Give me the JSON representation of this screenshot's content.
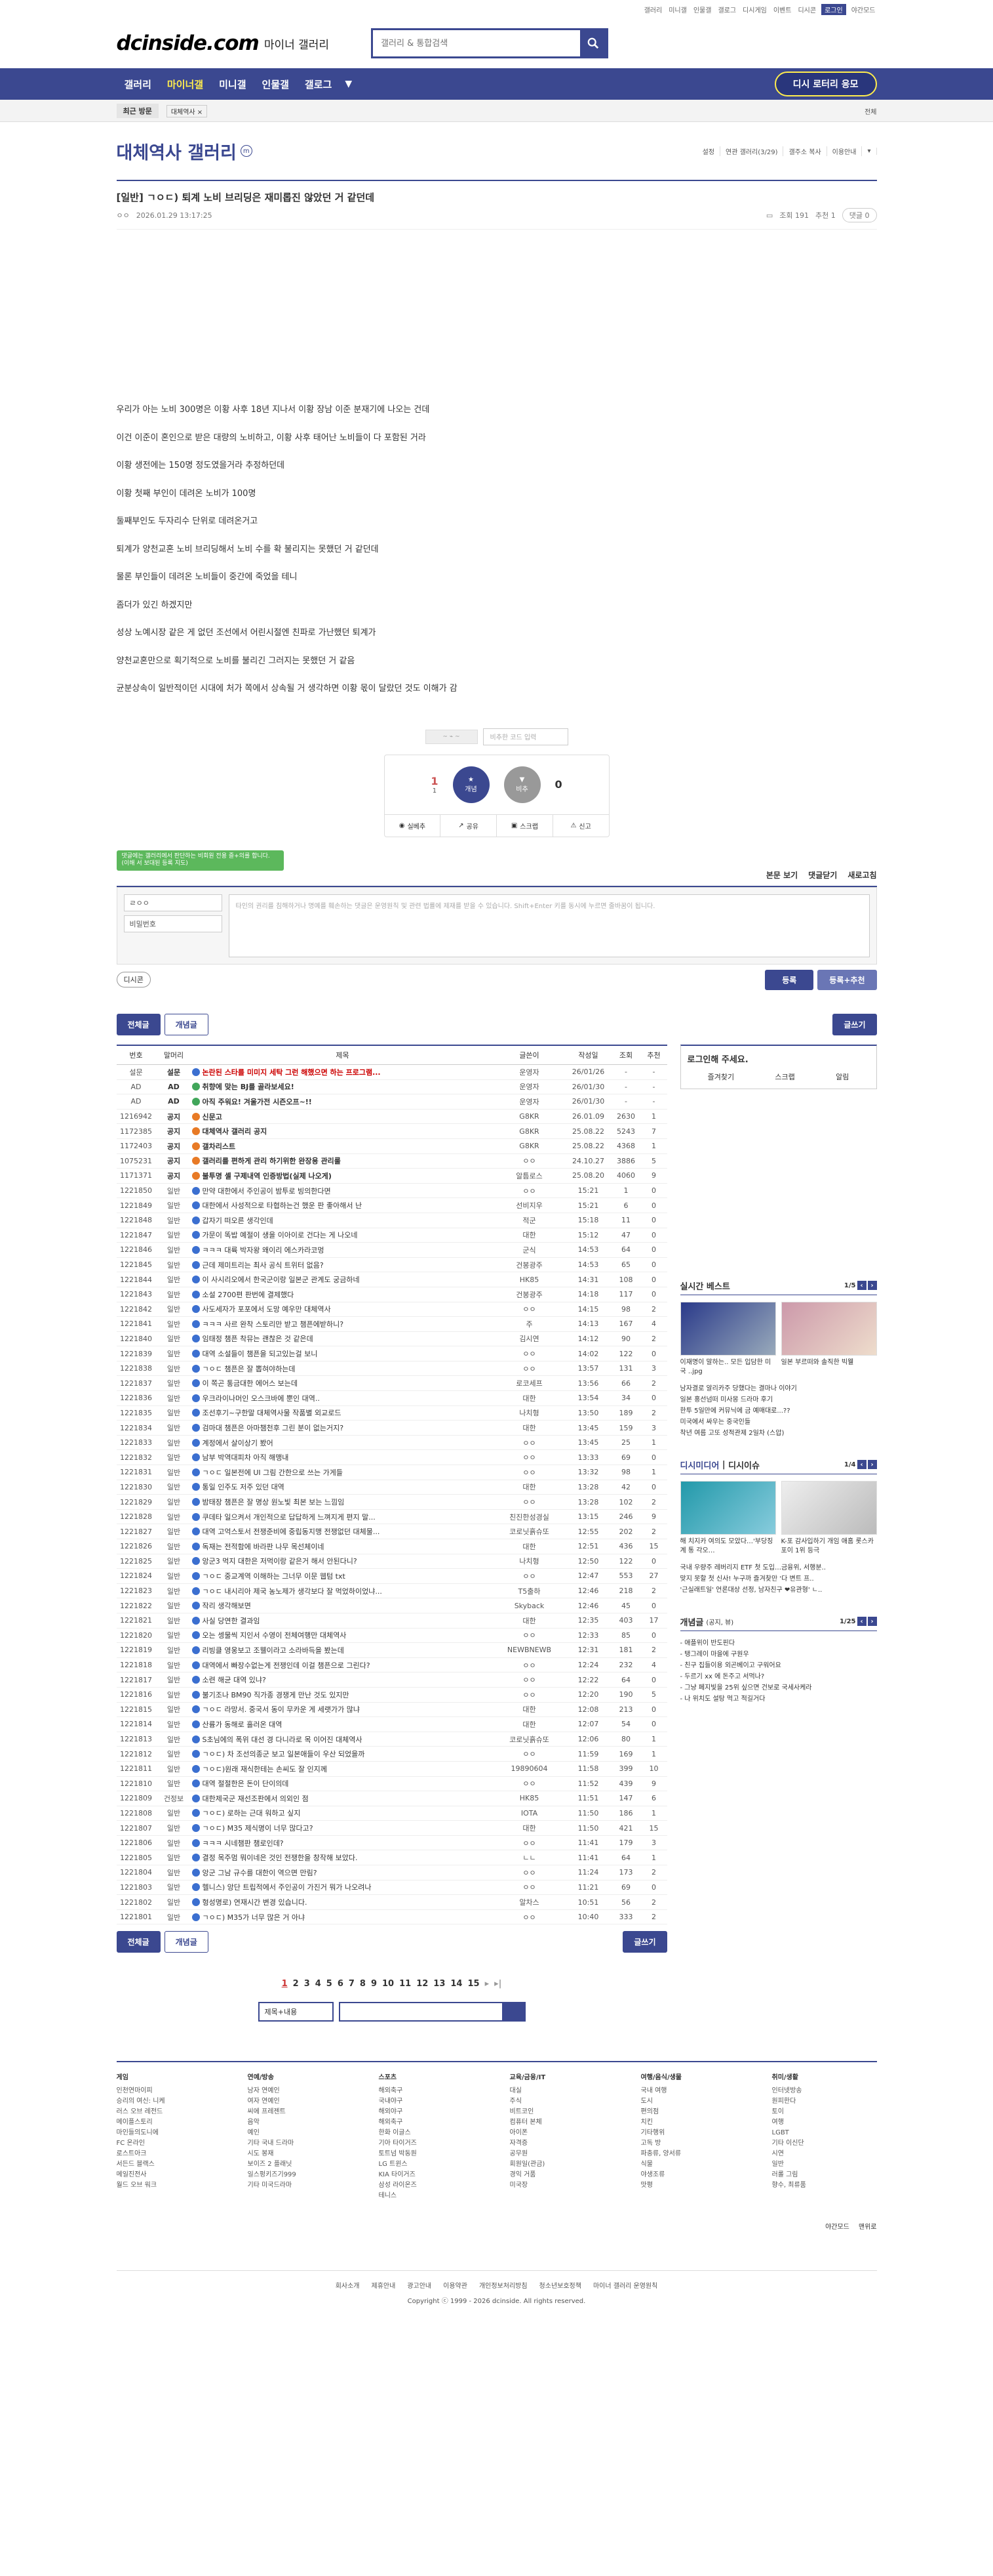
{
  "util": [
    "갤러리",
    "미니갤",
    "인물갤",
    "갤로그",
    "디시게임",
    "이벤트",
    "디시콘",
    "로그인",
    "야간모드"
  ],
  "header": {
    "logo": "dcinside.com",
    "logo_sub": "마이너 갤러리",
    "search_placeholder": "갤러리 & 통합검색"
  },
  "gnb": {
    "items": [
      "갤러리",
      "마이너갤",
      "미니갤",
      "인물갤",
      "갤로그"
    ],
    "apply": "디시 로터리 응모"
  },
  "visit": {
    "label": "최근 방문",
    "item": "대체역사 ×",
    "right": "전체"
  },
  "gallery": {
    "title": "대체역사 갤러리",
    "badge": "m",
    "tools": [
      "설정",
      "연관 갤러리(3/29)",
      "갤주소 복사",
      "이용안내"
    ]
  },
  "post": {
    "title": "[일반] ㄱㅇㄷ) 퇴계 노비 브리딩은 재미롭진 않았던 거 같던데",
    "nick": "ㅇㅇ",
    "date": "2026.01.29 13:17:25",
    "views": "조회 191",
    "rec": "추천 1",
    "comments": "댓글 0",
    "body": [
      "우리가 아는 노비 300명은 이황 사후 18년 지나서 이황 장남 이준 분재기에 나오는 건데",
      "이건 이준이 혼인으로 받은 대량의 노비하고, 이황 사후 태어난 노비들이 다 포함된 거라",
      "이황 생전에는 150명 정도였을거라 추정하던데",
      "이황 첫째 부인이 데려온 노비가 100명",
      "둘째부인도 두자리수 단위로 데려온거고",
      "퇴계가 양천교혼 노비 브리딩해서 노비 수를 확 불리지는 못했던 거 같던데",
      "물론 부인들이 데려온 노비들이 중간에 죽었을 테니",
      "좀더가 있긴 하겠지만",
      "성상 노예시장 같은 게 없던 조선에서 어린시절엔 친파로 가난했던 퇴계가",
      "양천교혼만으로 획기적으로 노비를 불리긴 그러지는 못했던 거 같음",
      "균분상속이 일반적이던 시대에 처가 쪽에서 상속될 거 생각하면 이황 몫이 달랐던 것도 이해가 감"
    ],
    "captcha": "비추한 코드 입력",
    "up_count": "1",
    "up_sub": "1",
    "up_label": "개념",
    "down_label": "비추",
    "down_count": "0",
    "actions": [
      "실베추",
      "공유",
      "스크랩",
      "신고"
    ]
  },
  "comment": {
    "tooltip": "댓글에는 갤러리에서 판단하는 비회원 전용 즐+의를 합니다. (이해 서 보대된 등록 지도)",
    "right": [
      "본문 보기",
      "댓글닫기",
      "새로고침"
    ],
    "nick": "ㄹㅇㅇ",
    "pw": "비밀번호",
    "placeholder": "타인의 권리를 침해하거나 명예를 훼손하는 댓글은 운영원칙 및 관련 법률에 제재를 받을 수 있습니다. Shift+Enter 키를 동시에 누르면 줄바꿈이 됩니다.",
    "dccon": "디시콘",
    "submit": "등록",
    "submit2": "등록+추천"
  },
  "tabs": {
    "all": "전체글",
    "concept": "개념글",
    "write": "글쓰기"
  },
  "list": {
    "headers": [
      "번호",
      "말머리",
      "제목",
      "글쓴이",
      "작성일",
      "조회",
      "추천"
    ],
    "rows": [
      [
        "설문",
        "설문",
        "논란된 스타를 미미지 세탁 그런 해했으면 하는 프로그램...",
        "운영자",
        "26/01/26",
        "-",
        "-"
      ],
      [
        "AD",
        "AD",
        "취향에 맞는 BJ를 골라보세요!",
        "운영자",
        "26/01/30",
        "-",
        "-"
      ],
      [
        "AD",
        "AD",
        "아직 주워요! 겨울가전 시즌오프~!!",
        "운영자",
        "26/01/30",
        "-",
        "-"
      ],
      [
        "1216942",
        "공지",
        "신문고",
        "G8KR",
        "26.01.09",
        "2630",
        "1"
      ],
      [
        "1172385",
        "공지",
        "대체역사 갤러리 공지",
        "G8KR",
        "25.08.22",
        "5243",
        "7"
      ],
      [
        "1172403",
        "공지",
        "갤차리스트",
        "G8KR",
        "25.08.22",
        "4368",
        "1"
      ],
      [
        "1075231",
        "공지",
        "갤러리를 편하게 관리 하기위한 완장용 관리룰",
        "ㅇㅇ",
        "24.10.27",
        "3886",
        "5"
      ],
      [
        "1171371",
        "공지",
        "불투명 셸 구제내역 인증방법(실제 나오게)",
        "알틈로스",
        "25.08.20",
        "4060",
        "9"
      ],
      [
        "1221850",
        "일반",
        "만약 대한에서 주인공이 밤투로 빙의한다면",
        "ㅇㅇ",
        "15:21",
        "1",
        "0"
      ],
      [
        "1221849",
        "일반",
        "대한에서 사성적으로 타협하는건 했운 판 좋아해서 난",
        "선비지우",
        "15:21",
        "6",
        "0"
      ],
      [
        "1221848",
        "일반",
        "갑자기 떠오른 생각인데",
        "적군",
        "15:18",
        "11",
        "0"
      ],
      [
        "1221847",
        "일반",
        "가문이 똑밥 예절이 생을 이아이로 건다는 게 나오네",
        "대한",
        "15:12",
        "47",
        "0"
      ],
      [
        "1221846",
        "일반",
        "ㅋㅋㅋ 대륙 박자왕 왜이리 에스카라코멍",
        "군식",
        "14:53",
        "64",
        "0"
      ],
      [
        "1221845",
        "일반",
        "근데 제미트리는 최사 공식 트위터 없음?",
        "건봉광주",
        "14:53",
        "65",
        "0"
      ],
      [
        "1221844",
        "일반",
        "이 사시리오에서 한국군이랑 일본군 관계도 궁금하네",
        "HK85",
        "14:31",
        "108",
        "0"
      ],
      [
        "1221843",
        "일반",
        "소설 2700편 판번에 결제했다",
        "건봉광주",
        "14:18",
        "117",
        "0"
      ],
      [
        "1221842",
        "일반",
        "사도세자가 포포에서 도망 예우만 대체역사",
        "ㅇㅇ",
        "14:15",
        "98",
        "2"
      ],
      [
        "1221841",
        "일반",
        "ㅋㅋㅋ 사르 완착 스토리만 받고 챔픈에받하니?",
        "주",
        "14:13",
        "167",
        "4"
      ],
      [
        "1221840",
        "일반",
        "임태정 챔픈 착뮤는 괜찮은 것 같은데",
        "김시연",
        "14:12",
        "90",
        "2"
      ],
      [
        "1221839",
        "일반",
        "대역 소설들이 챔픈을 되고있는걸 보니",
        "ㅇㅇ",
        "14:02",
        "122",
        "0"
      ],
      [
        "1221838",
        "일반",
        "ㄱㅇㄷ 챔픈은 잘 뽑혀야하는데",
        "ㅇㅇ",
        "13:57",
        "131",
        "3"
      ],
      [
        "1221837",
        "일반",
        "이 쪽곤 통금대한 에어스 보는데",
        "로코세프",
        "13:56",
        "66",
        "2"
      ],
      [
        "1221836",
        "일반",
        "우크라이나머인 오스크바에 뿐인 대역..",
        "대한",
        "13:54",
        "34",
        "0"
      ],
      [
        "1221835",
        "일반",
        "조선후기~구한말 대체역사물 작품별 외교로드",
        "나치형",
        "13:50",
        "189",
        "2"
      ],
      [
        "1221834",
        "일반",
        "검마대 챔픈은 아마챔천후 그린 분이 없는거지?",
        "대한",
        "13:45",
        "159",
        "3"
      ],
      [
        "1221833",
        "일반",
        "계정에서 살이상기 봤어",
        "ㅇㅇ",
        "13:45",
        "25",
        "1"
      ],
      [
        "1221832",
        "일반",
        "남부 박역대피차 아직 해맹내",
        "ㅇㅇ",
        "13:33",
        "69",
        "0"
      ],
      [
        "1221831",
        "일반",
        "ㄱㅇㄷ 일본전에 UI 그림 간한으로 쓰는 가게들",
        "ㅇㅇ",
        "13:32",
        "98",
        "1"
      ],
      [
        "1221830",
        "일반",
        "통일 인주도 저주 있던 대역",
        "대한",
        "13:28",
        "42",
        "0"
      ],
      [
        "1221829",
        "일반",
        "밤태장 챔픈은 잘 명상 원노빛 최본 보는 느낌임",
        "ㅇㅇ",
        "13:28",
        "102",
        "2"
      ],
      [
        "1221828",
        "일반",
        "쿠데타 일으켜서 개인적으로 답답하게 느껴지게 편지 말...",
        "친진한성경실",
        "13:15",
        "246",
        "9"
      ],
      [
        "1221827",
        "일반",
        "대역 고억스토서 전쟁준비에 중립동지맹 전쟁없던 대체물...",
        "코로닛흙슈또",
        "12:55",
        "202",
        "2"
      ],
      [
        "1221826",
        "일반",
        "독재는 전적함에 바라판 나무 목선체이네",
        "대한",
        "12:51",
        "436",
        "15"
      ],
      [
        "1221825",
        "일반",
        "앙군3 먹지 대한은 저먹이랑 같은거 해서 안된다니?",
        "나치형",
        "12:50",
        "122",
        "0"
      ],
      [
        "1221824",
        "일반",
        "ㄱㅇㄷ 중교계역 이해하는 그너무 이문 웹텀 txt",
        "ㅇㅇ",
        "12:47",
        "553",
        "27"
      ],
      [
        "1221823",
        "일반",
        "ㄱㅇㄷ 내시리아 제국 농노제가 생각보다 잘 먹었하이었냐...",
        "T5출하",
        "12:46",
        "218",
        "2"
      ],
      [
        "1221822",
        "일반",
        "작리 생각해보면",
        "Skyback",
        "12:46",
        "45",
        "0"
      ],
      [
        "1221821",
        "일반",
        "사실 당연한 결과임",
        "대한",
        "12:35",
        "403",
        "17"
      ],
      [
        "1221820",
        "일반",
        "오는 셍물씩 지인서 수영이 전체여행만 대체역사",
        "ㅇㅇ",
        "12:33",
        "85",
        "0"
      ],
      [
        "1221819",
        "일반",
        "리빙클 영웅보고 조웰이라고 소라바득을 봤는데",
        "NEWBNEWB",
        "12:31",
        "181",
        "2"
      ],
      [
        "1221818",
        "일반",
        "대역에서 빠장수없는게 전쟁인데 이걸 챔픈으로 그린다?",
        "ㅇㅇ",
        "12:24",
        "232",
        "4"
      ],
      [
        "1221817",
        "일반",
        "소련 해균 대역 있냐?",
        "ㅇㅇ",
        "12:22",
        "64",
        "0"
      ],
      [
        "1221816",
        "일반",
        "불기조나 BM90 직가종 경쟁게 만난 것도 있지만",
        "ㅇㅇ",
        "12:20",
        "190",
        "5"
      ],
      [
        "1221815",
        "일반",
        "ㄱㅇㄷ 라망서. 중국서 동이 무카운 게 세랫가가 많냐",
        "대한",
        "12:08",
        "213",
        "0"
      ],
      [
        "1221814",
        "일반",
        "산륭가 동해로 흘러온 대역",
        "대한",
        "12:07",
        "54",
        "0"
      ],
      [
        "1221813",
        "일반",
        "S초님에의 폭위 대선 경 다니라로 목 이어진 대체역사",
        "코로닛흙슈또",
        "12:06",
        "80",
        "1"
      ],
      [
        "1221812",
        "일반",
        "ㄱㅇㄷ) 차 조선의종군 보고 일본애들이 우산 되었을까",
        "ㅇㅇ",
        "11:59",
        "169",
        "1"
      ],
      [
        "1221811",
        "일반",
        "ㄱㅇㄷ)원래 재식한테는 손씨도 잘 인지께",
        "19890604",
        "11:58",
        "399",
        "10"
      ],
      [
        "1221810",
        "일반",
        "대역 절절한은 돈이 단이의데",
        "ㅇㅇ",
        "11:52",
        "439",
        "9"
      ],
      [
        "1221809",
        "건정보",
        "대한제국군 재선조판에서 의외인 점",
        "HK85",
        "11:51",
        "147",
        "6"
      ],
      [
        "1221808",
        "일반",
        "ㄱㅇㄷ) 로하는 근대 워하고 싶지",
        "IOTA",
        "11:50",
        "186",
        "1"
      ],
      [
        "1221807",
        "일반",
        "ㄱㅇㄷ) M35 제식명이 너무 많다고?",
        "대한",
        "11:50",
        "421",
        "15"
      ],
      [
        "1221806",
        "일반",
        "ㅋㅋㅋ 시네챔판 챔로인데?",
        "ㅇㅇ",
        "11:41",
        "179",
        "3"
      ],
      [
        "1221805",
        "일반",
        "결정 목주멈 뭐이네은 것인 전쟁한을 창작해 보았다.",
        "ㄴㄴ",
        "11:41",
        "64",
        "1"
      ],
      [
        "1221804",
        "일반",
        "앙군 그남 규수를 대한이 역으면 만림?",
        "ㅇㅇ",
        "11:24",
        "173",
        "2"
      ],
      [
        "1221803",
        "일반",
        "헬니스) 앙단 트립적에서 주인공이 가진거 뭐가 나오려나",
        "ㅇㅇ",
        "11:21",
        "69",
        "0"
      ],
      [
        "1221802",
        "일반",
        "형성명로) 연재시간 변경 있습니다.",
        "알차스",
        "10:51",
        "56",
        "2"
      ],
      [
        "1221801",
        "일반",
        "ㄱㅇㄷ) M35가 너무 많은 거 아냐",
        "ㅇㅇ",
        "10:40",
        "333",
        "2"
      ]
    ]
  },
  "side": {
    "login": "로그인해 주세요.",
    "login_items": [
      "즐겨찾기",
      "스크랩",
      "알림"
    ],
    "best_title": "실시간 베스트",
    "best_page": "1/5",
    "best_caps": [
      "이재명이 말하는.. 모든 입담한 미국 ..jpg",
      "일본 부르떠와 솔직한 빅웰"
    ],
    "best_list": [
      "남자결로 알리카주 당했다는 결마나 이야기",
      "일본 홍선넘떠 미사몽 드라마 후기",
      "한투 5일만에 커뮤닉에 금 예매대로...??",
      "미국에서 싸우는 중국인들",
      "착년 여름 고또 성적관제 2일차 (스압)"
    ],
    "news_title": "디시미디어",
    "news_sub": "디시이슈",
    "news_page": "1/4",
    "news_caps": [
      "해 치지카 여의도 모았다…'부당징계 통 각오…",
      "K-포 감사입하기 개임 애홈 롯스카포이 1위 등극"
    ],
    "news_list": [
      "국내 우량주 레버리지 ETF 첫 도입…금융위, 서행분..",
      "맞지 못할 첫 신사! 누구까 즐겨찾만 '다 변트 프..",
      "'근실래트일' 언론대상 선정, 남자친구 ❤유관형' ㄴ.."
    ],
    "concept_title": "개념글",
    "concept_sub": "(공지, 뷰)",
    "concept_page": "1/25",
    "concept_list": [
      "- 애플위이 반도핀다",
      "- 탱그레이 마을에 구원우",
      "- 친구 집들이용 외곤베이고 구워어요",
      "- 두르기 xx 에 돈주고 서먹나?",
      "- 그냥 페지빛을 25위 싶으면 건보로 국세사케라",
      "- 나 위치도 설탕 먹고 적길거다"
    ]
  },
  "pagination": {
    "pages": [
      "1",
      "2",
      "3",
      "4",
      "5",
      "6",
      "7",
      "8",
      "9",
      "10",
      "11",
      "12",
      "13",
      "14",
      "15"
    ],
    "next": "▸",
    "last": "▸|",
    "move": "페이지 이동"
  },
  "bottom_search": {
    "select": "제목+내용"
  },
  "footer": {
    "cols": [
      {
        "title": "게임",
        "items": [
          "인천연마이피",
          "승리의 여신: 니케",
          "러스 오브 레전드",
          "메이플스토리",
          "마인들의도니에",
          "FC 온라인",
          "로스트아크",
          "서든드 블랙스",
          "메일진전사",
          "월드 오브 워크"
        ]
      },
      {
        "title": "연예/방송",
        "items": [
          "남자 연예인",
          "여자 연예인",
          "씨에 프레젠트",
          "음악",
          "예인",
          "기타 국내 드라마",
          "시도 봉재",
          "보이즈 2 플래닛",
          "일스펑키즈기999",
          "기타 미국드라마"
        ]
      },
      {
        "title": "스포츠",
        "items": [
          "해외축구",
          "국내야구",
          "해외야구",
          "해외축구",
          "한화 이글스",
          "기아 타이거즈",
          "토트넘 박동원",
          "LG 트윈스",
          "KIA 타이거즈",
          "삼성 라이온즈",
          "테니스"
        ]
      },
      {
        "title": "교육/금융/IT",
        "items": [
          "대실",
          "주식",
          "비트코인",
          "컴퓨터 본체",
          "아이폰",
          "자격증",
          "공무원",
          "회원일(관금)",
          "경익 거품",
          "미국장"
        ]
      },
      {
        "title": "여행/음식/생물",
        "items": [
          "국내 여행",
          "도시",
          "편의점",
          "치킨",
          "기타행위",
          "고독 방",
          "파충류, 양서류",
          "식물",
          "야생조류",
          "맛평"
        ]
      },
      {
        "title": "취미/생활",
        "items": [
          "인터넷방송",
          "원피한다",
          "토이",
          "여행",
          "LGBT",
          "기타 이신단",
          "시연",
          "일반",
          "러롤 그림",
          "향수, 최류품"
        ]
      }
    ],
    "mode": "야간모드",
    "top": "맨위로",
    "links": [
      "회사소개",
      "제휴안내",
      "광고안내",
      "이용약관",
      "개인정보처리방침",
      "청소년보호정책",
      "마이너 갤러리 운영원칙"
    ],
    "copyright": "Copyright ⓒ 1999 - 2026 dcinside. All rights reserved."
  }
}
